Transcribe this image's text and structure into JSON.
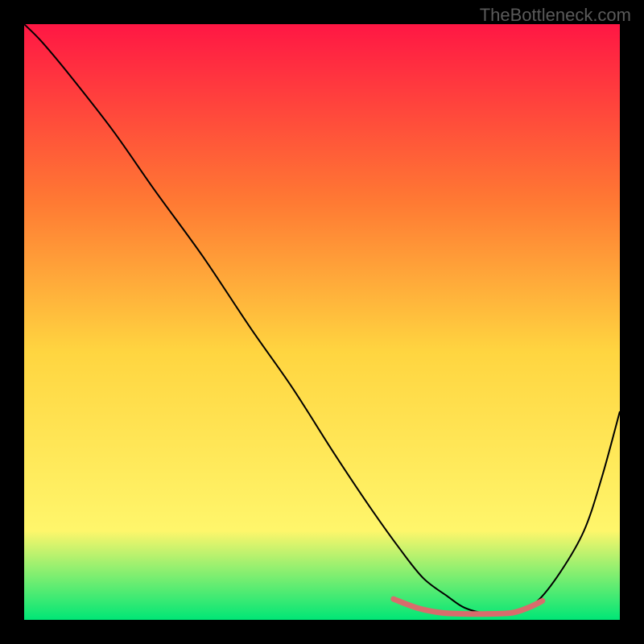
{
  "watermark": "TheBottleneck.com",
  "chart_data": {
    "type": "line",
    "title": "",
    "xlabel": "",
    "ylabel": "",
    "xlim": [
      0,
      100
    ],
    "ylim": [
      0,
      100
    ],
    "gradient_background": {
      "top": "#ff1744",
      "mid_upper": "#ff7a33",
      "mid": "#ffd540",
      "mid_lower": "#fff66b",
      "bottom": "#00e676"
    },
    "series": [
      {
        "name": "curve",
        "color": "#000000",
        "stroke_width": 2,
        "x": [
          0,
          3,
          8,
          15,
          22,
          30,
          38,
          45,
          52,
          58,
          63,
          67,
          71,
          74,
          78,
          82,
          86,
          90,
          94,
          97,
          100
        ],
        "y": [
          100,
          97,
          91,
          82,
          72,
          61,
          49,
          39,
          28,
          19,
          12,
          7,
          4,
          2,
          1,
          1,
          3,
          8,
          15,
          24,
          35
        ]
      },
      {
        "name": "highlight-band",
        "color": "#d86c6c",
        "stroke_width": 7,
        "x": [
          62,
          66,
          70,
          74,
          78,
          82,
          85,
          87
        ],
        "y": [
          3.5,
          2.0,
          1.2,
          1.0,
          1.0,
          1.2,
          2.2,
          3.2
        ]
      }
    ]
  }
}
